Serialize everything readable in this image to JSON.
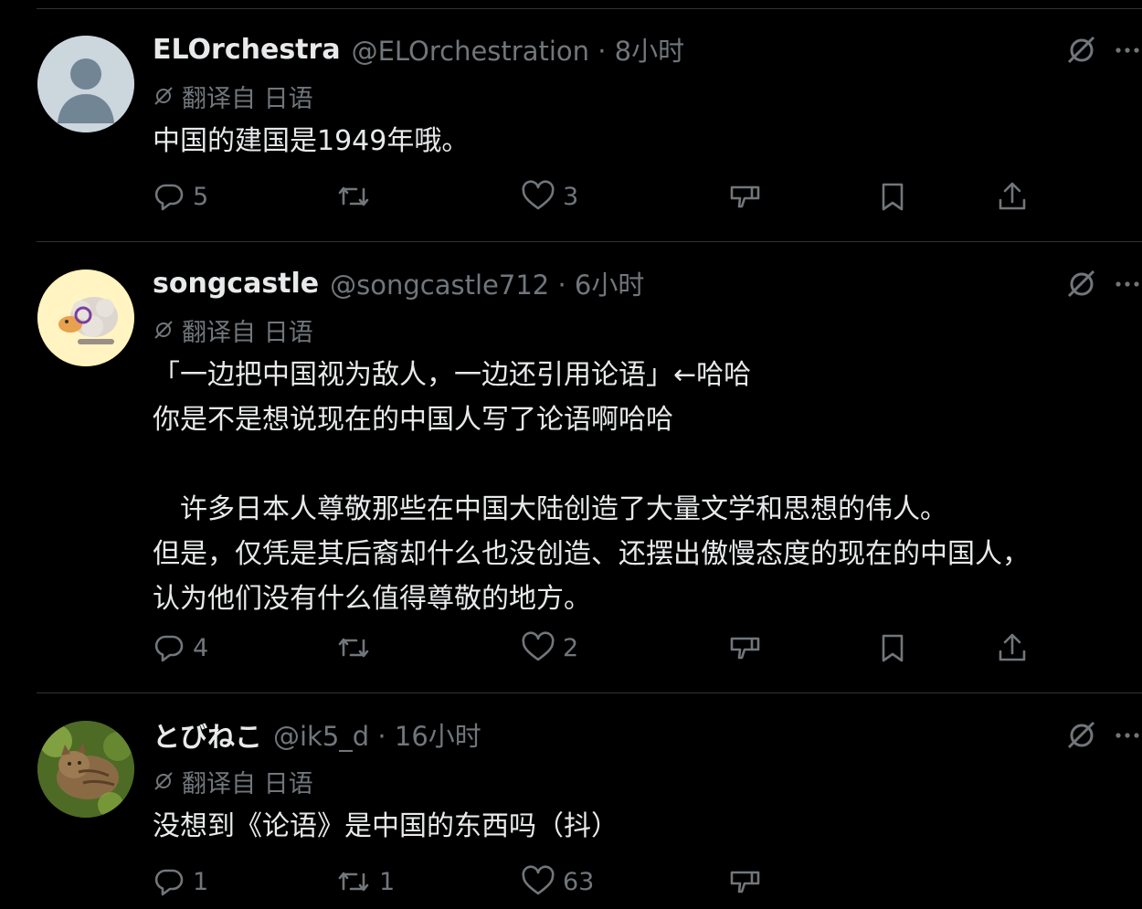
{
  "posts": [
    {
      "name": "ELOrchestra",
      "handle": "@ELOrchestration · 8小时",
      "translation_label": "翻译自 日语",
      "text": "中国的建国是1949年哦。",
      "replies": "5",
      "reposts": "",
      "likes": "3",
      "avatar": "default-person-avatar"
    },
    {
      "name": "songcastle",
      "handle": "@songcastle712 · 6小时",
      "translation_label": "翻译自 日语",
      "text": "「一边把中国视为敌人，一边还引用论语」←哈哈\n你是不是想说现在的中国人写了论语啊哈哈\n\n　许多日本人尊敬那些在中国大陆创造了大量文学和思想的伟人。\n但是，仅凭是其后裔却什么也没创造、还摆出傲慢态度的现在的中国人，\n认为他们没有什么值得尊敬的地方。",
      "replies": "4",
      "reposts": "",
      "likes": "2",
      "avatar": "sheep-illustration-avatar"
    },
    {
      "name": "とびねこ",
      "handle": "@ik5_d · 16小时",
      "translation_label": "翻译自 日语",
      "text": "没想到《论语》是中国的东西吗（抖）",
      "replies": "1",
      "reposts": "1",
      "likes": "63",
      "avatar": "cat-photo-avatar"
    }
  ],
  "colors": {
    "background": "#000000",
    "primary_text": "#e7e9ea",
    "secondary_text": "#71767b",
    "separator": "#2f3336"
  },
  "icons": [
    "reply-icon",
    "repost-icon",
    "like-icon",
    "dislike-icon",
    "bookmark-icon",
    "share-icon",
    "grok-icon",
    "more-icon",
    "translate-icon"
  ]
}
